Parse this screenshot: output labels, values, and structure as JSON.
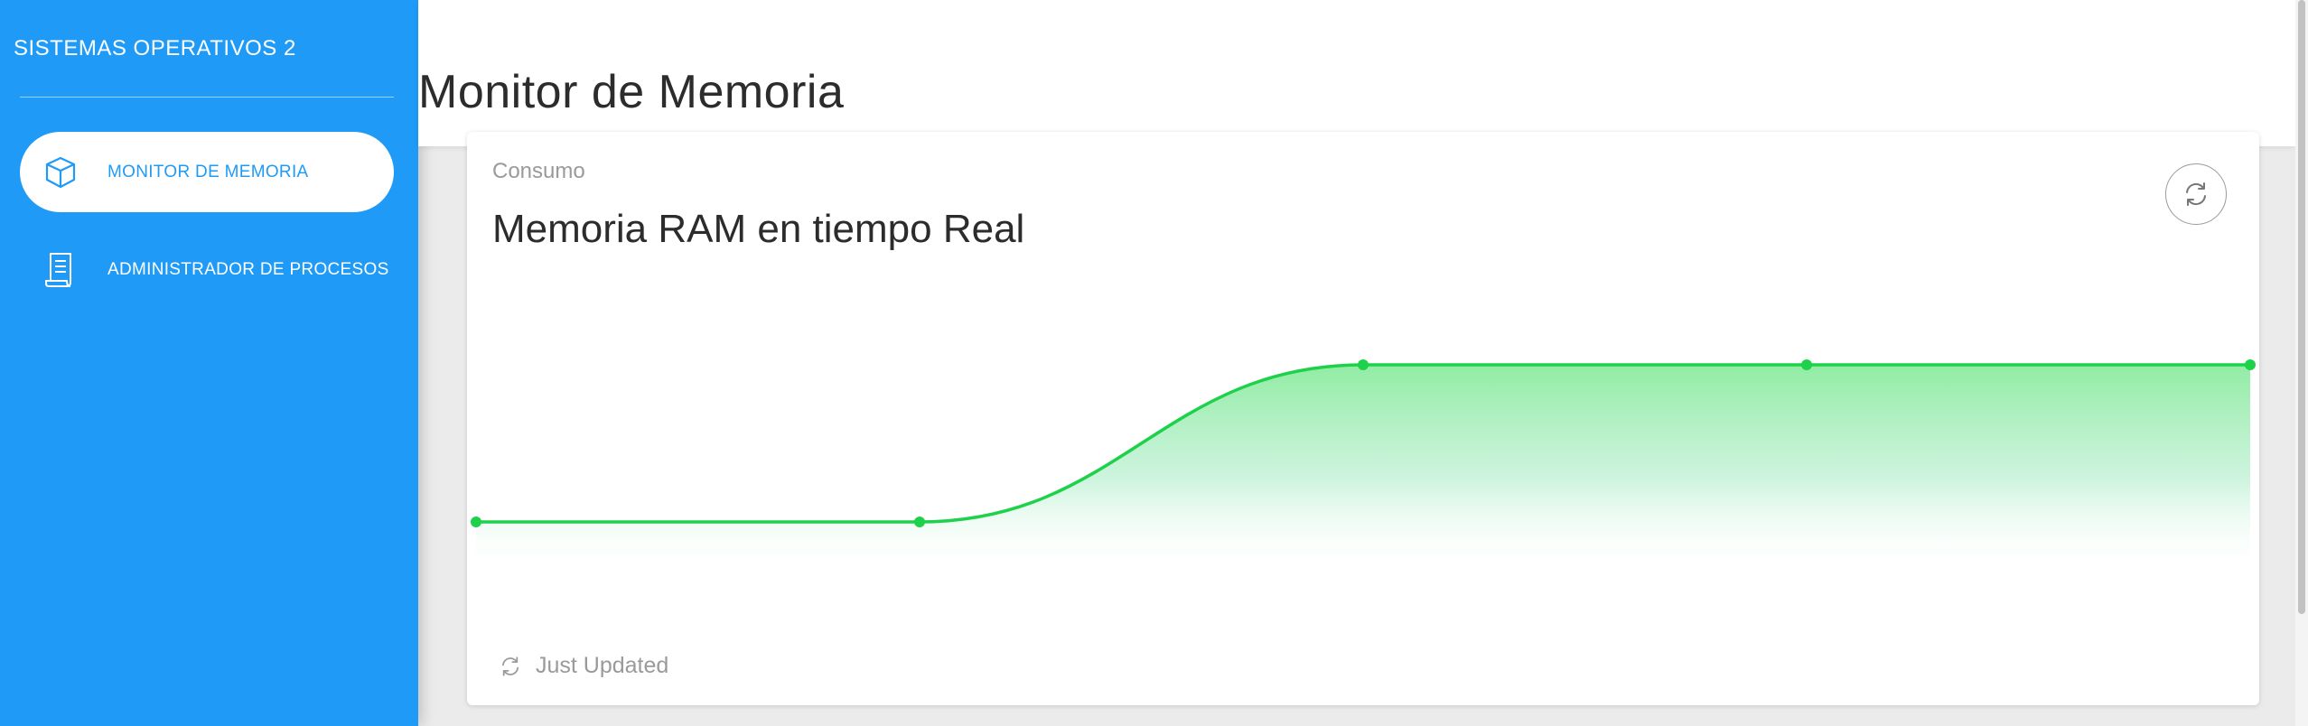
{
  "sidebar": {
    "brand": "SISTEMAS OPERATIVOS 2",
    "items": [
      {
        "label": "MONITOR DE MEMORIA",
        "icon": "cube-icon",
        "active": true
      },
      {
        "label": "ADMINISTRADOR DE PROCESOS",
        "icon": "document-icon",
        "active": false
      }
    ]
  },
  "header": {
    "title": "Monitor de Memoria"
  },
  "card": {
    "category": "Consumo",
    "title": "Memoria RAM en tiempo Real",
    "refresh_icon": "refresh-icon",
    "footer": "Just Updated",
    "footer_icon": "refresh-icon"
  },
  "colors": {
    "sidebar_bg": "#1f9bf7",
    "line": "#1ed14b",
    "fill_top": "#8beb9e"
  },
  "chart_data": {
    "type": "area",
    "title": "",
    "xlabel": "",
    "ylabel": "",
    "x": [
      0,
      1,
      2,
      3,
      4
    ],
    "values": [
      0.2,
      0.2,
      0.8,
      0.8,
      0.8
    ],
    "ylim": [
      0,
      1
    ],
    "grid": false,
    "legend": "none"
  }
}
